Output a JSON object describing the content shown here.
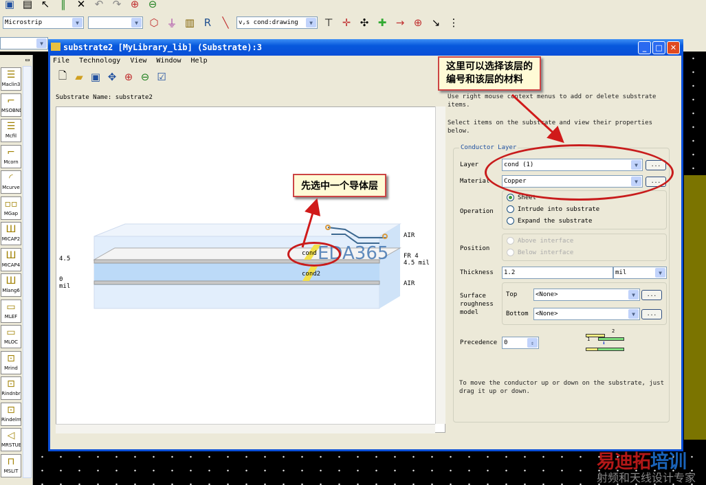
{
  "toolbar": {
    "mode_select": "Microstrip",
    "second_select": "",
    "layer_select": "v,s cond:drawing"
  },
  "window": {
    "title": "substrate2 [MyLibrary_lib] (Substrate):3",
    "minimize": "_",
    "maximize": "□",
    "close": "✕"
  },
  "menu": [
    "File",
    "Technology",
    "View",
    "Window",
    "Help"
  ],
  "palette": [
    "Maclin3",
    "MSOBND",
    "Mcfil",
    "Mcorn",
    "Mcurve",
    "MGap",
    "MICAP2",
    "MICAP4",
    "Mlang6",
    "MLEF",
    "MLOC",
    "Mrind",
    "Rindnbr",
    "Rindelm",
    "MRSTUB",
    "MSLIT"
  ],
  "substrate_name_label": "Substrate Name:",
  "substrate_name": "substrate2",
  "diagram": {
    "left_top": "4.5",
    "left_bottom_1": "0",
    "left_bottom_2": "mil",
    "right_air_top": "AIR",
    "right_fr4": "FR 4",
    "right_fr4_thk": "4.5 mil",
    "right_air_bottom": "AIR",
    "cond1": "cond",
    "cond2": "cond2",
    "watermark": "EDA365"
  },
  "help1": "Use right mouse context menus to add or delete substrate items.",
  "help2": "Select items on the substrate and view their properties below.",
  "conductor": {
    "group_title": "Conductor Layer",
    "layer_label": "Layer",
    "layer_value": "cond (1)",
    "material_label": "Material",
    "material_value": "Copper",
    "more": "...",
    "operation_label": "Operation",
    "operations": [
      "Sheet",
      "Intrude into substrate",
      "Expand the substrate"
    ],
    "position_label": "Position",
    "positions": [
      "Above interface",
      "Below interface"
    ],
    "thickness_label": "Thickness",
    "thickness_value": "1.2",
    "thickness_unit": "mil",
    "surface_label_1": "Surface",
    "surface_label_2": "roughness",
    "surface_label_3": "model",
    "top_label": "Top",
    "top_value": "<None>",
    "bottom_label": "Bottom",
    "bottom_value": "<None>",
    "precedence_label": "Precedence",
    "precedence_value": "0",
    "prec_fig_1": "1",
    "prec_fig_2": "2"
  },
  "help3": "To move the conductor up or down on the substrate, just drag it up or down.",
  "callouts": {
    "right": "这里可以选择该层的\n编号和该层的材料",
    "left": "先选中一个导体层"
  },
  "watermark": {
    "line1a": "易迪拓",
    "line1b": "培训",
    "line2": "射频和天线设计专家"
  }
}
